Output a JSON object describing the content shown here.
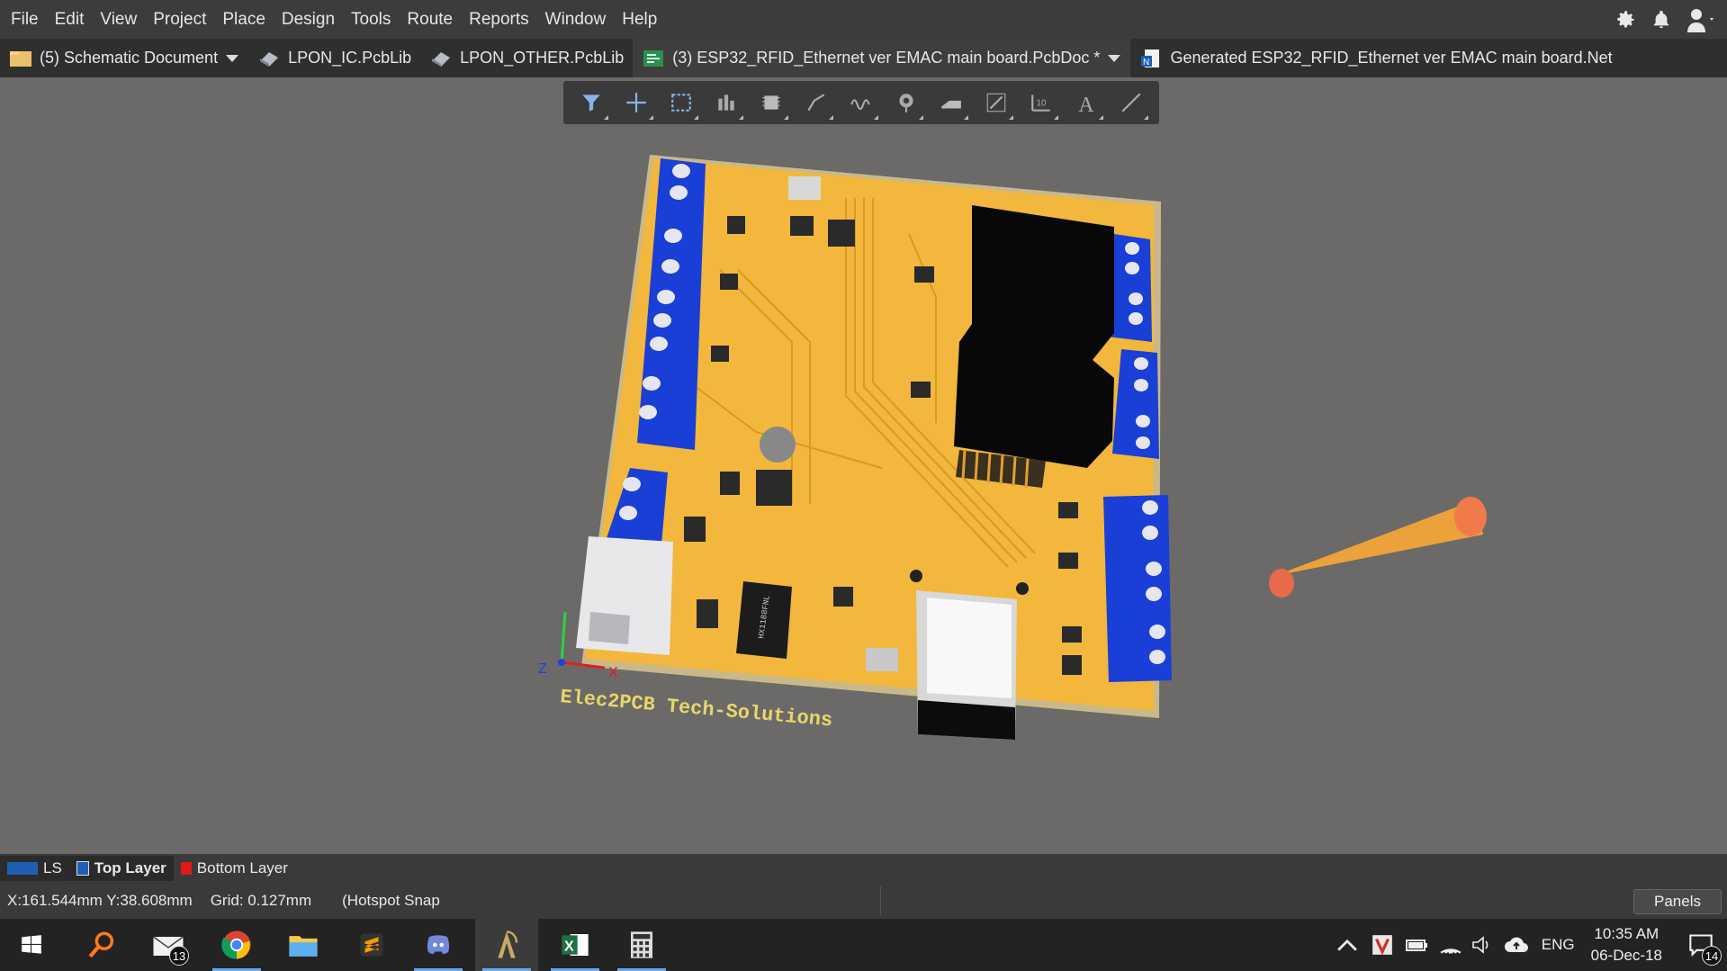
{
  "menu": {
    "items": [
      "File",
      "Edit",
      "View",
      "Project",
      "Place",
      "Design",
      "Tools",
      "Route",
      "Reports",
      "Window",
      "Help"
    ]
  },
  "tabs": [
    {
      "label": "(5) Schematic Document",
      "icon": "schematic-icon"
    },
    {
      "label": "LPON_IC.PcbLib",
      "icon": "pcblib-icon"
    },
    {
      "label": "LPON_OTHER.PcbLib",
      "icon": "pcblib-icon"
    },
    {
      "label": "(3) ESP32_RFID_Ethernet ver EMAC main board.PcbDoc *",
      "icon": "pcbdoc-icon",
      "active": true
    },
    {
      "label": "Generated ESP32_RFID_Ethernet ver EMAC main board.Net",
      "icon": "netlist-icon"
    }
  ],
  "board": {
    "silkscreen_text": "Elec2PCB Tech-Solutions",
    "chip_label": "HX1188FNL",
    "axis_z": "Z",
    "axis_x": "X"
  },
  "layers": {
    "ls": "LS",
    "top": "Top Layer",
    "bottom": "Bottom Layer",
    "top_color": "#1e5fb4",
    "bottom_color": "#e01818"
  },
  "status": {
    "coords": "X:161.544mm Y:38.608mm",
    "grid": "Grid: 0.127mm",
    "snap": "(Hotspot Snap",
    "panels": "Panels"
  },
  "taskbar": {
    "mail_badge": "13",
    "lang": "ENG",
    "time": "10:35 AM",
    "date": "06-Dec-18",
    "notif_badge": "14"
  },
  "colors": {
    "board": "#f2b73c",
    "terminal_blue": "#1a3fd6",
    "accent": "#6aa7e8"
  }
}
